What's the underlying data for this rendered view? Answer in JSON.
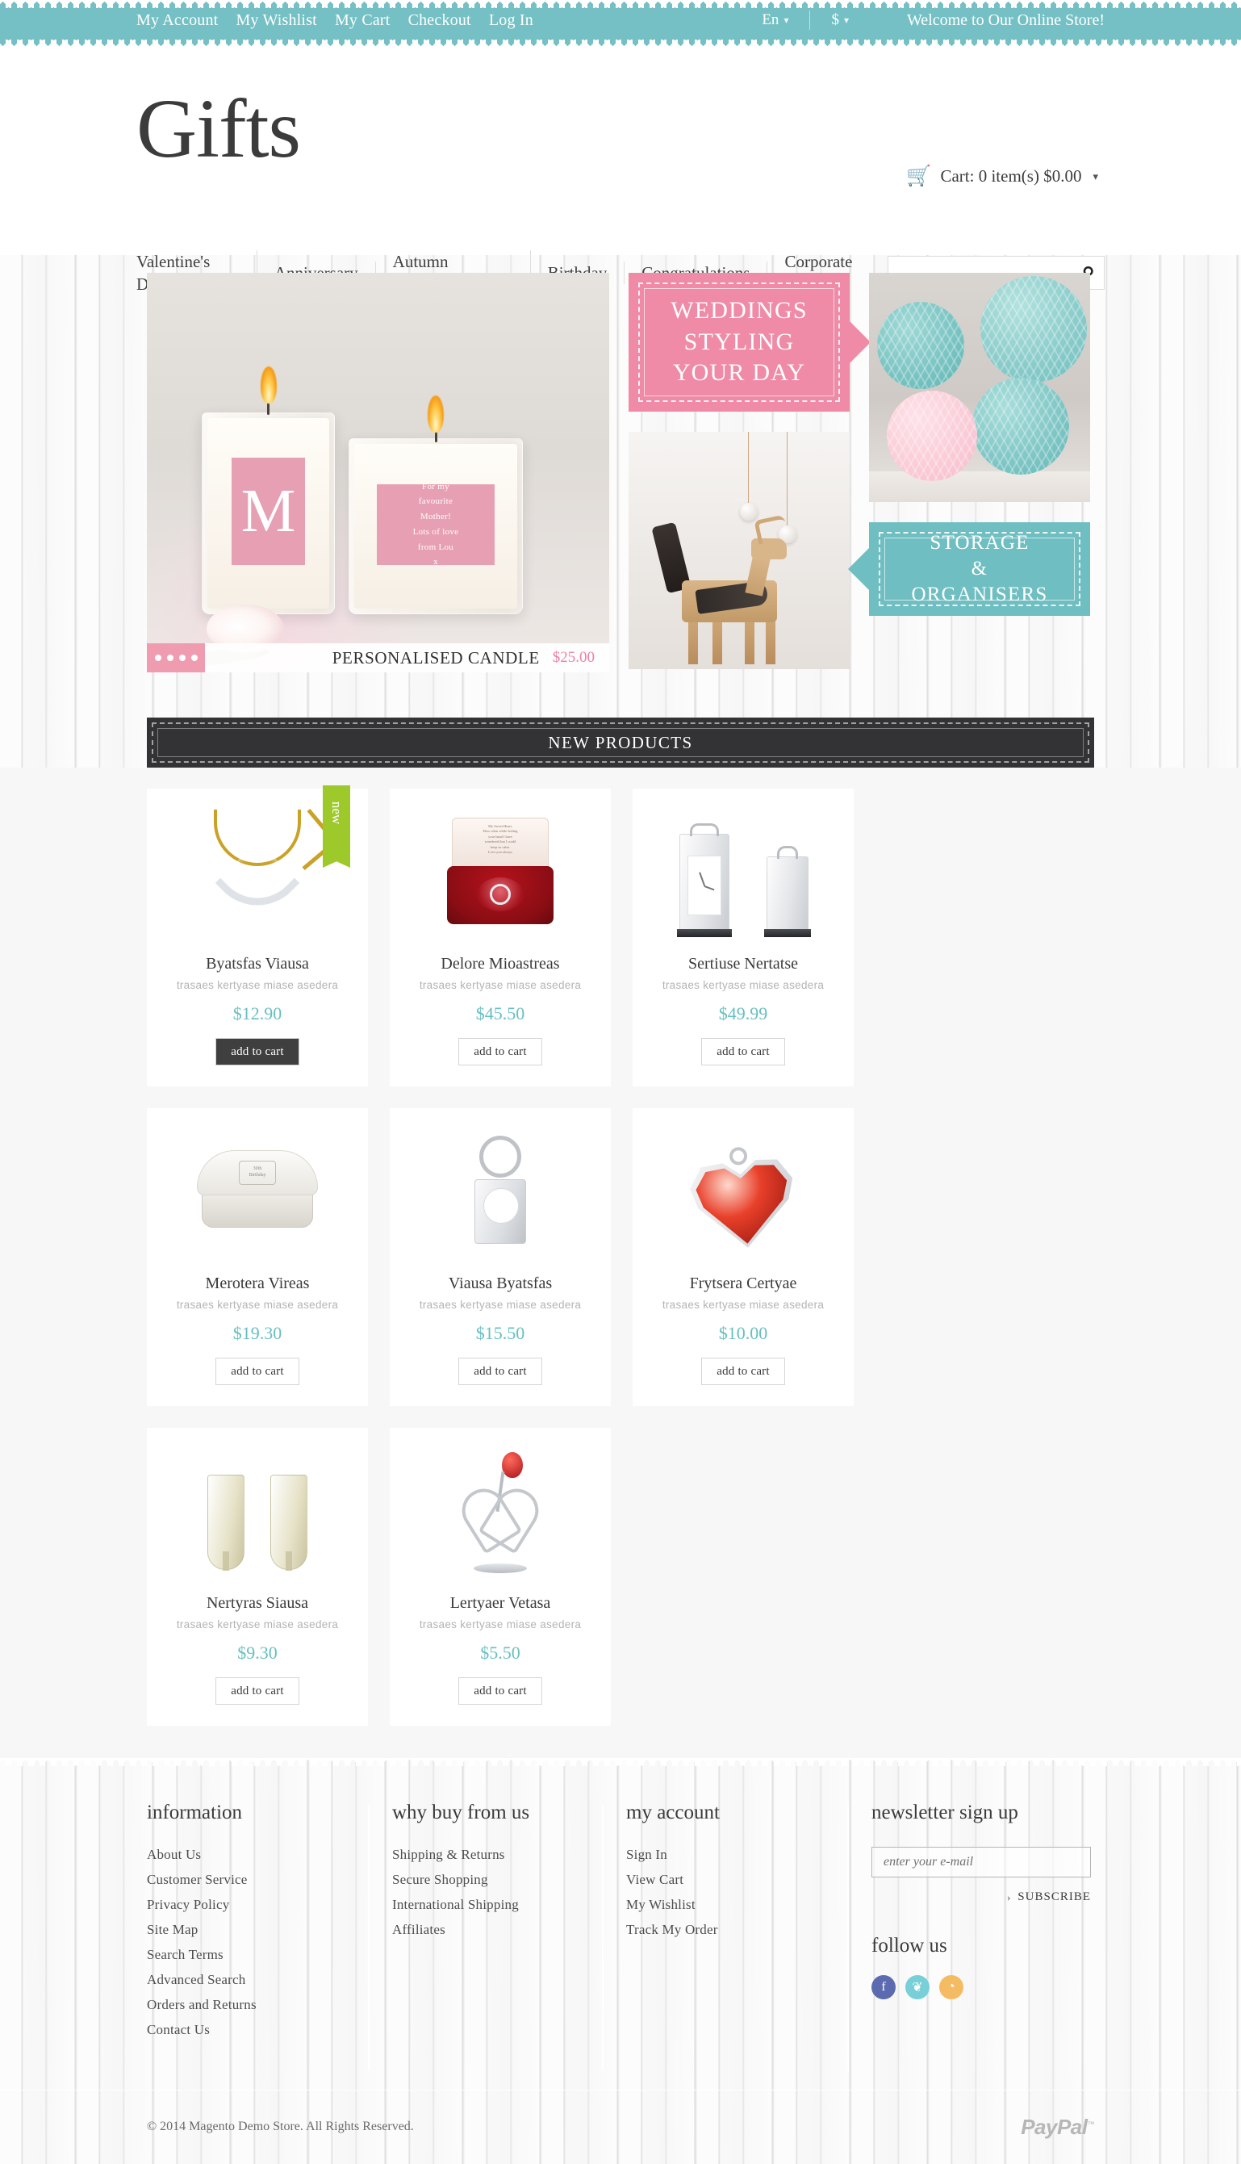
{
  "topbar": {
    "links": [
      {
        "label": "My Account"
      },
      {
        "label": "My Wishlist"
      },
      {
        "label": "My Cart"
      },
      {
        "label": "Checkout"
      },
      {
        "label": "Log In"
      }
    ],
    "language": "En",
    "currency": "$",
    "welcome": "Welcome to Our Online Store!",
    "background_color": "#74c0c4"
  },
  "header": {
    "logo": "Gifts",
    "cart": {
      "icon": "shopping-cart-icon",
      "label": "Cart: 0 item(s) $0.00",
      "items": 0,
      "total": "$0.00"
    },
    "nav": [
      {
        "label": "Valentine's Day"
      },
      {
        "label": "Anniversary"
      },
      {
        "label": "Autumn Bouquets"
      },
      {
        "label": "Birthday"
      },
      {
        "label": "Congratulations"
      },
      {
        "label": "Corporate Gifts"
      }
    ],
    "search": {
      "value": "",
      "placeholder": "",
      "icon": "search-icon"
    }
  },
  "hero": {
    "slider": {
      "caption_name": "PERSONALISED CANDLE",
      "caption_price": "$25.00",
      "dots": 4,
      "candle_monogram": "M",
      "candle_note_lines": [
        "For my",
        "favourite",
        "Mother!",
        "Lots of love",
        "from Lou",
        "x"
      ]
    },
    "banner_pink": {
      "lines": [
        "WEDDINGS",
        "STYLING",
        "YOUR DAY"
      ],
      "color": "#ef8ba6"
    },
    "banner_teal": {
      "lines": [
        "STORAGE",
        "&",
        "ORGANISERS"
      ],
      "color": "#6fbec2"
    }
  },
  "new_products": {
    "section_title": "NEW PRODUCTS",
    "badge_new": "new",
    "add_to_cart_label": "add to cart",
    "price_color": "#67bfc2",
    "items": [
      {
        "name": "Byatsfas Viausa",
        "desc": "trasaes kertyase miase asedera",
        "price": "$12.90",
        "art": "heart-necklace",
        "badge": "new",
        "button_active": true
      },
      {
        "name": "Delore Mioastreas",
        "desc": "trasaes kertyase miase asedera",
        "price": "$45.50",
        "art": "ring-box",
        "badge": "",
        "button_active": false
      },
      {
        "name": "Sertiuse Nertatse",
        "desc": "trasaes kertyase miase asedera",
        "price": "$49.99",
        "art": "carriage-clocks",
        "badge": "",
        "button_active": false
      },
      {
        "name": "Merotera Vireas",
        "desc": "trasaes kertyase miase asedera",
        "price": "$19.30",
        "art": "jewellery-box",
        "badge": "",
        "button_active": false
      },
      {
        "name": "Viausa Byatsfas",
        "desc": "trasaes kertyase miase asedera",
        "price": "$15.50",
        "art": "keyring-watch",
        "badge": "",
        "button_active": false
      },
      {
        "name": "Frytsera Certyae",
        "desc": "trasaes kertyase miase asedera",
        "price": "$10.00",
        "art": "heart-stone",
        "badge": "",
        "button_active": false
      },
      {
        "name": "Nertyras Siausa",
        "desc": "trasaes kertyase miase asedera",
        "price": "$9.30",
        "art": "champagne-flutes",
        "badge": "",
        "button_active": false
      },
      {
        "name": "Lertyaer Vetasa",
        "desc": "trasaes kertyase miase asedera",
        "price": "$5.50",
        "art": "rose-figurine",
        "badge": "",
        "button_active": false
      }
    ]
  },
  "footer": {
    "columns": [
      {
        "heading": "information",
        "links": [
          {
            "label": "About Us"
          },
          {
            "label": "Customer Service"
          },
          {
            "label": "Privacy Policy"
          },
          {
            "label": "Site Map"
          },
          {
            "label": "Search Terms"
          },
          {
            "label": "Advanced Search"
          },
          {
            "label": "Orders and Returns"
          },
          {
            "label": "Contact Us"
          }
        ]
      },
      {
        "heading": "why buy from us",
        "links": [
          {
            "label": "Shipping & Returns"
          },
          {
            "label": "Secure Shopping"
          },
          {
            "label": "International Shipping"
          },
          {
            "label": "Affiliates"
          }
        ]
      },
      {
        "heading": "my account",
        "links": [
          {
            "label": "Sign In"
          },
          {
            "label": "View Cart"
          },
          {
            "label": "My Wishlist"
          },
          {
            "label": "Track My Order"
          }
        ]
      }
    ],
    "newsletter": {
      "heading": "newsletter sign up",
      "placeholder": "enter your e-mail",
      "value": "",
      "subscribe_label": "SUBSCRIBE",
      "subscribe_arrow": "›"
    },
    "follow": {
      "heading": "follow us",
      "socials": [
        {
          "name": "facebook-icon",
          "glyph": "f",
          "color": "#5c6bb0"
        },
        {
          "name": "twitter-icon",
          "glyph": "❦",
          "color": "#77cfd7"
        },
        {
          "name": "rss-icon",
          "glyph": "◔",
          "color": "#f5bb62"
        }
      ]
    },
    "copyright": "© 2014 Magento Demo Store. All Rights Reserved.",
    "payment": "PayPal"
  }
}
